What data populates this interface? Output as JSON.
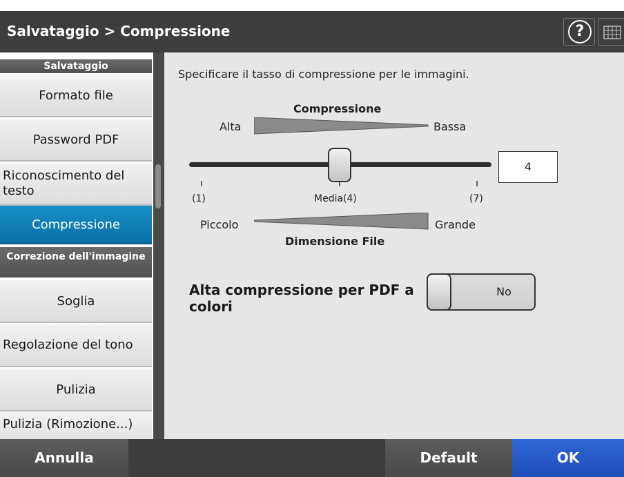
{
  "header": {
    "title": "Salvataggio > Compressione",
    "help_label": "?"
  },
  "sidebar": {
    "section1_title": "Salvataggio",
    "items1": [
      "Formato file",
      "Password PDF",
      "Riconoscimento del testo",
      "Compressione"
    ],
    "section2_title": "Correzione dell'immagine",
    "items2": [
      "Soglia",
      "Regolazione del tono",
      "Pulizia",
      "Pulizia (Rimozione...)"
    ],
    "active_item": "Compressione"
  },
  "main": {
    "description": "Specificare il tasso di compressione per le immagini.",
    "compression_label": "Compressione",
    "high_label": "Alta",
    "low_label": "Bassa",
    "tick_min": "(1)",
    "tick_mid": "Media(4)",
    "tick_max": "(7)",
    "small_label": "Piccolo",
    "large_label": "Grande",
    "file_size_label": "Dimensione File",
    "slider": {
      "min": 1,
      "max": 7,
      "value": 4
    },
    "value_display": "4",
    "high_compression_label": "Alta compressione per PDF a colori",
    "high_compression_value": "No"
  },
  "footer": {
    "cancel_label": "Annulla",
    "default_label": "Default",
    "ok_label": "OK"
  },
  "colors": {
    "header_bg": "#3d3d3d",
    "active_item": "#0a6fa5",
    "ok_button": "#1f4fb8",
    "panel_bg": "#e6e6e6"
  },
  "icons": [
    "help-icon",
    "keyboard-icon"
  ]
}
